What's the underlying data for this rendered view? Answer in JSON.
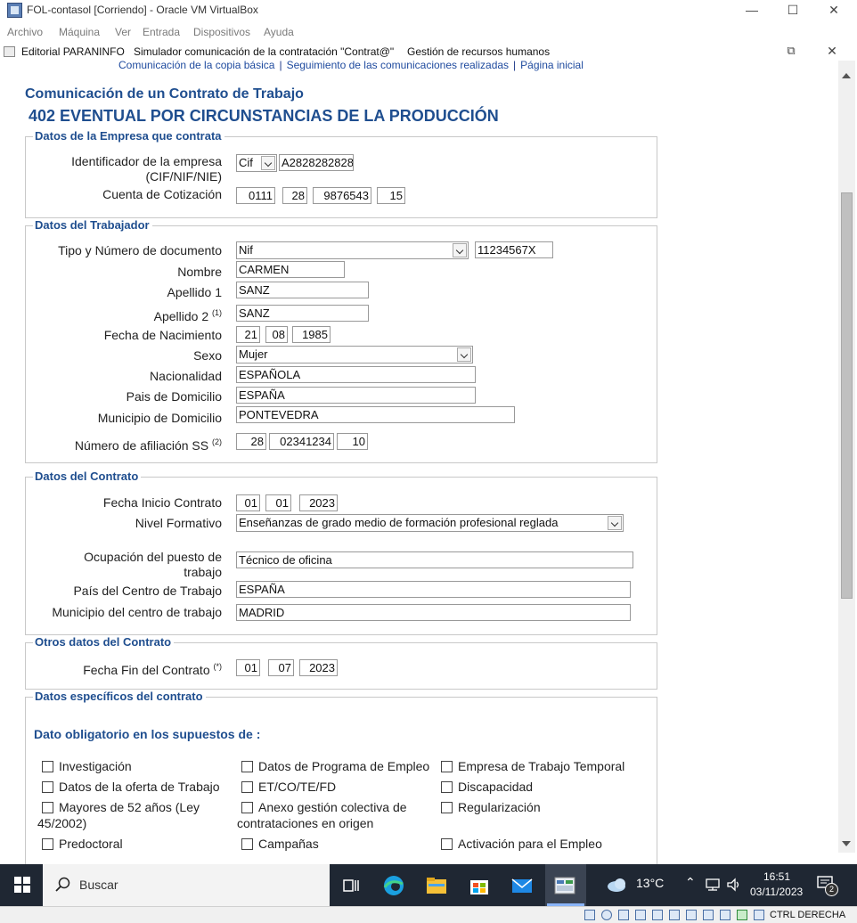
{
  "vbox": {
    "title": "FOL-contasol [Corriendo] - Oracle VM VirtualBox",
    "menu": [
      "Archivo",
      "Máquina",
      "Ver",
      "Entrada",
      "Dispositivos",
      "Ayuda"
    ],
    "host_key": "CTRL DERECHA"
  },
  "guest": {
    "menu": [
      "Editorial PARANINFO",
      "Simulador comunicación de la contratación \"Contrat@\"",
      "Gestión de recursos humanos"
    ],
    "links": [
      "Comunicación de la copia básica",
      "Seguimiento de las comunicaciones realizadas",
      "Página inicial"
    ]
  },
  "page": {
    "title": "Comunicación de un Contrato de Trabajo",
    "contract_type": "402 EVENTUAL POR CIRCUNSTANCIAS DE LA PRODUCCIÓN"
  },
  "empresa": {
    "legend": "Datos de la Empresa que contrata",
    "id_label_1": "Identificador de la empresa",
    "id_label_2": "(CIF/NIF/NIE)",
    "id_type": "Cif",
    "id_value": "A2828282828",
    "cuenta_label": "Cuenta de Cotización",
    "cuenta": [
      "0111",
      "28",
      "9876543",
      "15"
    ]
  },
  "trabajador": {
    "legend": "Datos del Trabajador",
    "doc_label": "Tipo y Número de documento",
    "doc_type": "Nif",
    "doc_number": "11234567X",
    "nombre_label": "Nombre",
    "nombre": "CARMEN",
    "apellido1_label": "Apellido 1",
    "apellido1": "SANZ",
    "apellido2_label": "Apellido 2",
    "apellido2_note": "(1)",
    "apellido2": "SANZ",
    "nacimiento_label": "Fecha de Nacimiento",
    "nacimiento": [
      "21",
      "08",
      "1985"
    ],
    "sexo_label": "Sexo",
    "sexo": "Mujer",
    "nacionalidad_label": "Nacionalidad",
    "nacionalidad": "ESPAÑOLA",
    "pais_label": "Pais de Domicilio",
    "pais": "ESPAÑA",
    "municipio_label": "Municipio de Domicilio",
    "municipio": "PONTEVEDRA",
    "afiliacion_label": "Número de afiliación SS",
    "afiliacion_note": "(2)",
    "afiliacion": [
      "28",
      "02341234",
      "10"
    ]
  },
  "contrato": {
    "legend": "Datos del Contrato",
    "inicio_label": "Fecha Inicio Contrato",
    "inicio": [
      "01",
      "01",
      "2023"
    ],
    "nivel_label": "Nivel Formativo",
    "nivel": "Enseñanzas de grado medio de formación profesional reglada",
    "ocupacion_label_1": "Ocupación del puesto de",
    "ocupacion_label_2": "trabajo",
    "ocupacion": "Técnico de oficina",
    "pais_centro_label": "País del Centro de Trabajo",
    "pais_centro": "ESPAÑA",
    "municipio_centro_label": "Municipio del centro de trabajo",
    "municipio_centro": "MADRID"
  },
  "otros": {
    "legend": "Otros datos del Contrato",
    "fin_label": "Fecha Fin del Contrato",
    "fin_note": "(*)",
    "fin": [
      "01",
      "07",
      "2023"
    ]
  },
  "especificos": {
    "legend": "Datos específicos del contrato",
    "heading": "Dato obligatorio en los supuestos de :",
    "checkboxes": [
      "Investigación",
      "Datos de Programa de Empleo",
      "Empresa de Trabajo Temporal",
      "Datos de la oferta de Trabajo",
      "ET/CO/TE/FD",
      "Discapacidad",
      "Mayores de 52 años (Ley",
      "45/2002)",
      "Anexo gestión colectiva de",
      "contrataciones en origen",
      "Regularización",
      "Predoctoral",
      "Campañas",
      "Activación para el Empleo"
    ]
  },
  "taskbar": {
    "search": "Buscar",
    "weather": "13°C",
    "time": "16:51",
    "date": "03/11/2023",
    "notifications": "2"
  }
}
